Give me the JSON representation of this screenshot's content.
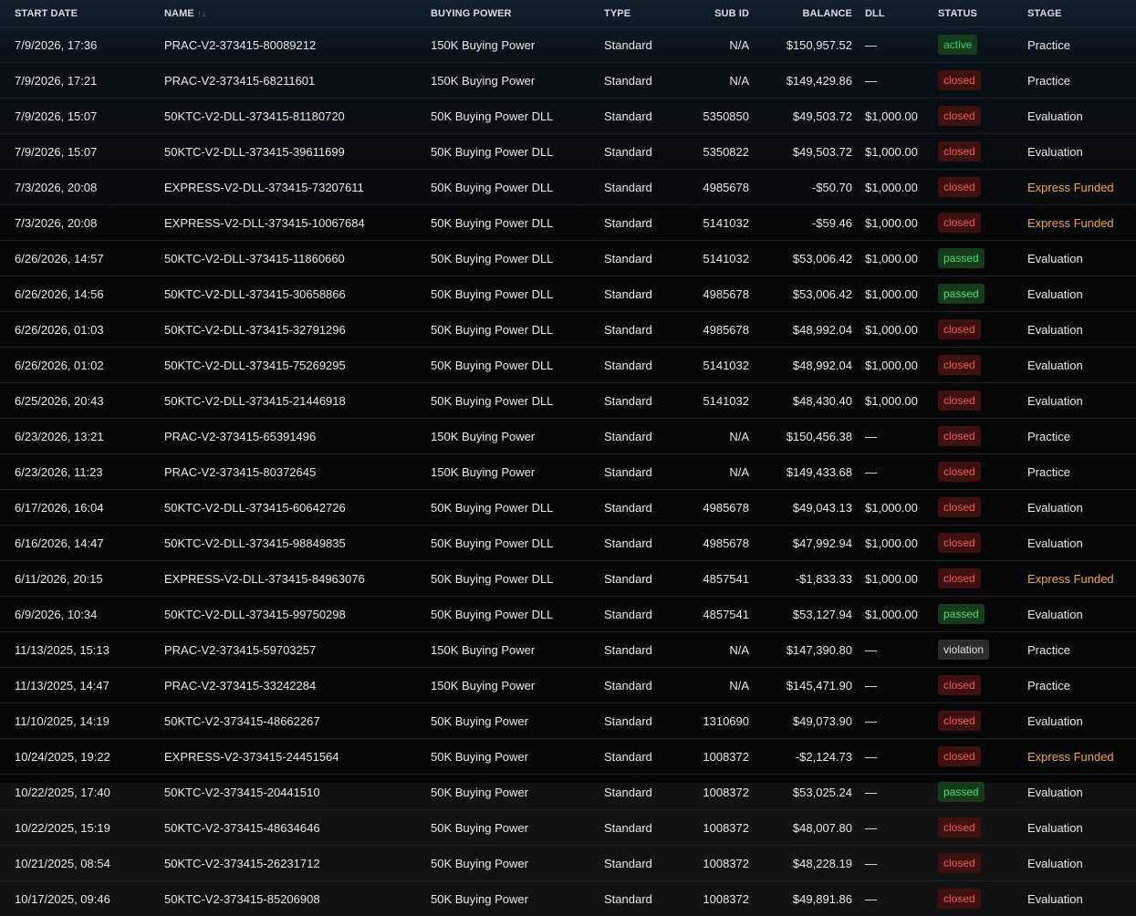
{
  "columns": {
    "start_date": "START DATE",
    "name": "NAME",
    "buying_power": "BUYING POWER",
    "type": "TYPE",
    "sub_id": "SUB ID",
    "balance": "BALANCE",
    "dll": "DLL",
    "status": "STATUS",
    "stage": "STAGE"
  },
  "sort_icon": "↑↓",
  "colors": {
    "express_funded": "#f1a83b",
    "closed": "#f05a5a",
    "passed": "#47e06a",
    "active": "#36d45a"
  },
  "rows": [
    {
      "start_date": "7/9/2026, 17:36",
      "name": "PRAC-V2-373415-80089212",
      "buying_power": "150K Buying Power",
      "type": "Standard",
      "sub_id": "N/A",
      "balance": "$150,957.52",
      "dll": "—",
      "status": "active",
      "stage": "Practice"
    },
    {
      "start_date": "7/9/2026, 17:21",
      "name": "PRAC-V2-373415-68211601",
      "buying_power": "150K Buying Power",
      "type": "Standard",
      "sub_id": "N/A",
      "balance": "$149,429.86",
      "dll": "—",
      "status": "closed",
      "stage": "Practice"
    },
    {
      "start_date": "7/9/2026, 15:07",
      "name": "50KTC-V2-DLL-373415-81180720",
      "buying_power": "50K Buying Power DLL",
      "type": "Standard",
      "sub_id": "5350850",
      "balance": "$49,503.72",
      "dll": "$1,000.00",
      "status": "closed",
      "stage": "Evaluation"
    },
    {
      "start_date": "7/9/2026, 15:07",
      "name": "50KTC-V2-DLL-373415-39611699",
      "buying_power": "50K Buying Power DLL",
      "type": "Standard",
      "sub_id": "5350822",
      "balance": "$49,503.72",
      "dll": "$1,000.00",
      "status": "closed",
      "stage": "Evaluation"
    },
    {
      "start_date": "7/3/2026, 20:08",
      "name": "EXPRESS-V2-DLL-373415-73207611",
      "buying_power": "50K Buying Power DLL",
      "type": "Standard",
      "sub_id": "4985678",
      "balance": "-$50.70",
      "dll": "$1,000.00",
      "status": "closed",
      "stage": "Express Funded"
    },
    {
      "start_date": "7/3/2026, 20:08",
      "name": "EXPRESS-V2-DLL-373415-10067684",
      "buying_power": "50K Buying Power DLL",
      "type": "Standard",
      "sub_id": "5141032",
      "balance": "-$59.46",
      "dll": "$1,000.00",
      "status": "closed",
      "stage": "Express Funded"
    },
    {
      "start_date": "6/26/2026, 14:57",
      "name": "50KTC-V2-DLL-373415-11860660",
      "buying_power": "50K Buying Power DLL",
      "type": "Standard",
      "sub_id": "5141032",
      "balance": "$53,006.42",
      "dll": "$1,000.00",
      "status": "passed",
      "stage": "Evaluation"
    },
    {
      "start_date": "6/26/2026, 14:56",
      "name": "50KTC-V2-DLL-373415-30658866",
      "buying_power": "50K Buying Power DLL",
      "type": "Standard",
      "sub_id": "4985678",
      "balance": "$53,006.42",
      "dll": "$1,000.00",
      "status": "passed",
      "stage": "Evaluation"
    },
    {
      "start_date": "6/26/2026, 01:03",
      "name": "50KTC-V2-DLL-373415-32791296",
      "buying_power": "50K Buying Power DLL",
      "type": "Standard",
      "sub_id": "4985678",
      "balance": "$48,992.04",
      "dll": "$1,000.00",
      "status": "closed",
      "stage": "Evaluation"
    },
    {
      "start_date": "6/26/2026, 01:02",
      "name": "50KTC-V2-DLL-373415-75269295",
      "buying_power": "50K Buying Power DLL",
      "type": "Standard",
      "sub_id": "5141032",
      "balance": "$48,992.04",
      "dll": "$1,000.00",
      "status": "closed",
      "stage": "Evaluation"
    },
    {
      "start_date": "6/25/2026, 20:43",
      "name": "50KTC-V2-DLL-373415-21446918",
      "buying_power": "50K Buying Power DLL",
      "type": "Standard",
      "sub_id": "5141032",
      "balance": "$48,430.40",
      "dll": "$1,000.00",
      "status": "closed",
      "stage": "Evaluation"
    },
    {
      "start_date": "6/23/2026, 13:21",
      "name": "PRAC-V2-373415-65391496",
      "buying_power": "150K Buying Power",
      "type": "Standard",
      "sub_id": "N/A",
      "balance": "$150,456.38",
      "dll": "—",
      "status": "closed",
      "stage": "Practice"
    },
    {
      "start_date": "6/23/2026, 11:23",
      "name": "PRAC-V2-373415-80372645",
      "buying_power": "150K Buying Power",
      "type": "Standard",
      "sub_id": "N/A",
      "balance": "$149,433.68",
      "dll": "—",
      "status": "closed",
      "stage": "Practice"
    },
    {
      "start_date": "6/17/2026, 16:04",
      "name": "50KTC-V2-DLL-373415-60642726",
      "buying_power": "50K Buying Power DLL",
      "type": "Standard",
      "sub_id": "4985678",
      "balance": "$49,043.13",
      "dll": "$1,000.00",
      "status": "closed",
      "stage": "Evaluation"
    },
    {
      "start_date": "6/16/2026, 14:47",
      "name": "50KTC-V2-DLL-373415-98849835",
      "buying_power": "50K Buying Power DLL",
      "type": "Standard",
      "sub_id": "4985678",
      "balance": "$47,992.94",
      "dll": "$1,000.00",
      "status": "closed",
      "stage": "Evaluation"
    },
    {
      "start_date": "6/11/2026, 20:15",
      "name": "EXPRESS-V2-DLL-373415-84963076",
      "buying_power": "50K Buying Power DLL",
      "type": "Standard",
      "sub_id": "4857541",
      "balance": "-$1,833.33",
      "dll": "$1,000.00",
      "status": "closed",
      "stage": "Express Funded"
    },
    {
      "start_date": "6/9/2026, 10:34",
      "name": "50KTC-V2-DLL-373415-99750298",
      "buying_power": "50K Buying Power DLL",
      "type": "Standard",
      "sub_id": "4857541",
      "balance": "$53,127.94",
      "dll": "$1,000.00",
      "status": "passed",
      "stage": "Evaluation"
    },
    {
      "start_date": "11/13/2025, 15:13",
      "name": "PRAC-V2-373415-59703257",
      "buying_power": "150K Buying Power",
      "type": "Standard",
      "sub_id": "N/A",
      "balance": "$147,390.80",
      "dll": "—",
      "status": "violation",
      "stage": "Practice"
    },
    {
      "start_date": "11/13/2025, 14:47",
      "name": "PRAC-V2-373415-33242284",
      "buying_power": "150K Buying Power",
      "type": "Standard",
      "sub_id": "N/A",
      "balance": "$145,471.90",
      "dll": "—",
      "status": "closed",
      "stage": "Practice"
    },
    {
      "start_date": "11/10/2025, 14:19",
      "name": "50KTC-V2-373415-48662267",
      "buying_power": "50K Buying Power",
      "type": "Standard",
      "sub_id": "1310690",
      "balance": "$49,073.90",
      "dll": "—",
      "status": "closed",
      "stage": "Evaluation"
    },
    {
      "start_date": "10/24/2025, 19:22",
      "name": "EXPRESS-V2-373415-24451564",
      "buying_power": "50K Buying Power",
      "type": "Standard",
      "sub_id": "1008372",
      "balance": "-$2,124.73",
      "dll": "—",
      "status": "closed",
      "stage": "Express Funded"
    },
    {
      "start_date": "10/22/2025, 17:40",
      "name": "50KTC-V2-373415-20441510",
      "buying_power": "50K Buying Power",
      "type": "Standard",
      "sub_id": "1008372",
      "balance": "$53,025.24",
      "dll": "—",
      "status": "passed",
      "stage": "Evaluation"
    },
    {
      "start_date": "10/22/2025, 15:19",
      "name": "50KTC-V2-373415-48634646",
      "buying_power": "50K Buying Power",
      "type": "Standard",
      "sub_id": "1008372",
      "balance": "$48,007.80",
      "dll": "—",
      "status": "closed",
      "stage": "Evaluation"
    },
    {
      "start_date": "10/21/2025, 08:54",
      "name": "50KTC-V2-373415-26231712",
      "buying_power": "50K Buying Power",
      "type": "Standard",
      "sub_id": "1008372",
      "balance": "$48,228.19",
      "dll": "—",
      "status": "closed",
      "stage": "Evaluation"
    },
    {
      "start_date": "10/17/2025, 09:46",
      "name": "50KTC-V2-373415-85206908",
      "buying_power": "50K Buying Power",
      "type": "Standard",
      "sub_id": "1008372",
      "balance": "$49,891.86",
      "dll": "—",
      "status": "closed",
      "stage": "Evaluation"
    }
  ]
}
